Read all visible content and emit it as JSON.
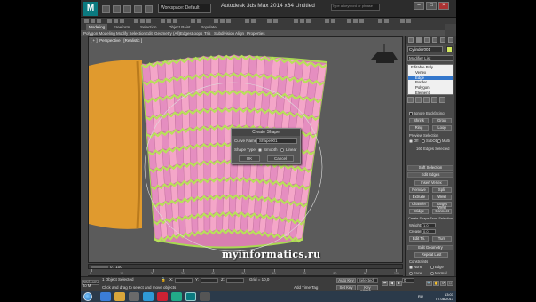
{
  "app": {
    "logo": "M",
    "workspace": "Workspace: Default",
    "title": "Autodesk 3ds Max  2014 x64      Untitled",
    "search_placeholder": "Type a keyword or phrase"
  },
  "ribbon": {
    "tabs": [
      "Modeling",
      "Freeform",
      "Selection",
      "Object Paint",
      "Populate"
    ],
    "active_tab": "Modeling",
    "sub_items": [
      "Polygon Modeling",
      "Modify Selection",
      "Edit",
      "Geometry (All)",
      "Edges",
      "Loops",
      "Tris",
      "Subdivision",
      "Align",
      "Properties"
    ]
  },
  "viewport": {
    "label": "[ + ] [Perspective ] [Realistic ]",
    "accent_fill": "#f4a6c8",
    "accent_edge": "#b8e05a",
    "cylinder_color": "#e09a2e"
  },
  "dialog": {
    "title": "Create Shape",
    "name_label": "Curve Name:",
    "name_value": "Shape001",
    "shape_type_label": "Shape Type:",
    "smooth": "Smooth",
    "linear": "Linear",
    "ok": "OK",
    "cancel": "Cancel"
  },
  "command_panel": {
    "object_name": "Cylinder001",
    "object_color": "#d2e85c",
    "modifier_list": "Modifier List",
    "stack": [
      "Editable Poly",
      "Vertex",
      "Edge",
      "Border",
      "Polygon",
      "Element"
    ],
    "stack_selected": 2,
    "ignore_backfacing": "Ignore Backfacing",
    "shrink": "Shrink",
    "grow": "Grow",
    "ring": "Ring",
    "loop": "Loop",
    "preview_selection": "Preview Selection",
    "off": "Off",
    "subobj": "SubObj",
    "multi": "Multi",
    "edges_selected": "160 Edges Selected",
    "soft_selection": "Soft Selection",
    "edit_edges": "Edit Edges",
    "insert_vertex": "Insert Vertex",
    "remove": "Remove",
    "split": "Split",
    "extrude": "Extrude",
    "weld": "Weld",
    "chamfer": "Chamfer",
    "target_weld": "Target Weld",
    "bridge": "Bridge",
    "connect": "Connect",
    "create_shape": "Create Shape From Selection",
    "weight_label": "Weight:",
    "weight_value": "1.0",
    "crease_label": "Crease:",
    "crease_value": "0.0",
    "edit_tri": "Edit Tri.",
    "turn": "Turn",
    "edit_geometry": "Edit Geometry",
    "repeat_last": "Repeat Last",
    "constraints": "Constraints",
    "none": "None",
    "edge": "Edge",
    "face": "Face",
    "normal": "Normal"
  },
  "timeline": {
    "frame_counter": "0 / 100",
    "ticks": [
      "0",
      "10",
      "20",
      "30",
      "40",
      "50",
      "60",
      "70",
      "80",
      "90",
      "100"
    ]
  },
  "status": {
    "maxscript": "Welcome to M",
    "objects_selected": "1 Object Selected",
    "prompt": "Click and drag to select and move objects",
    "click_tabs": "Click or click-and-drag to select objects",
    "x_label": "X:",
    "y_label": "Y:",
    "z_label": "Z:",
    "grid": "Grid = 10,0",
    "add_time_tag": "Add Time Tag",
    "auto_key": "Auto Key",
    "selected": "Selected",
    "set_key": "Set Key",
    "key_filters": "Key Filters...",
    "frame_value": "0"
  },
  "taskbar": {
    "time": "13:03",
    "date": "07.08.2013",
    "lang": "RU"
  },
  "watermark": "myinformatics.ru"
}
